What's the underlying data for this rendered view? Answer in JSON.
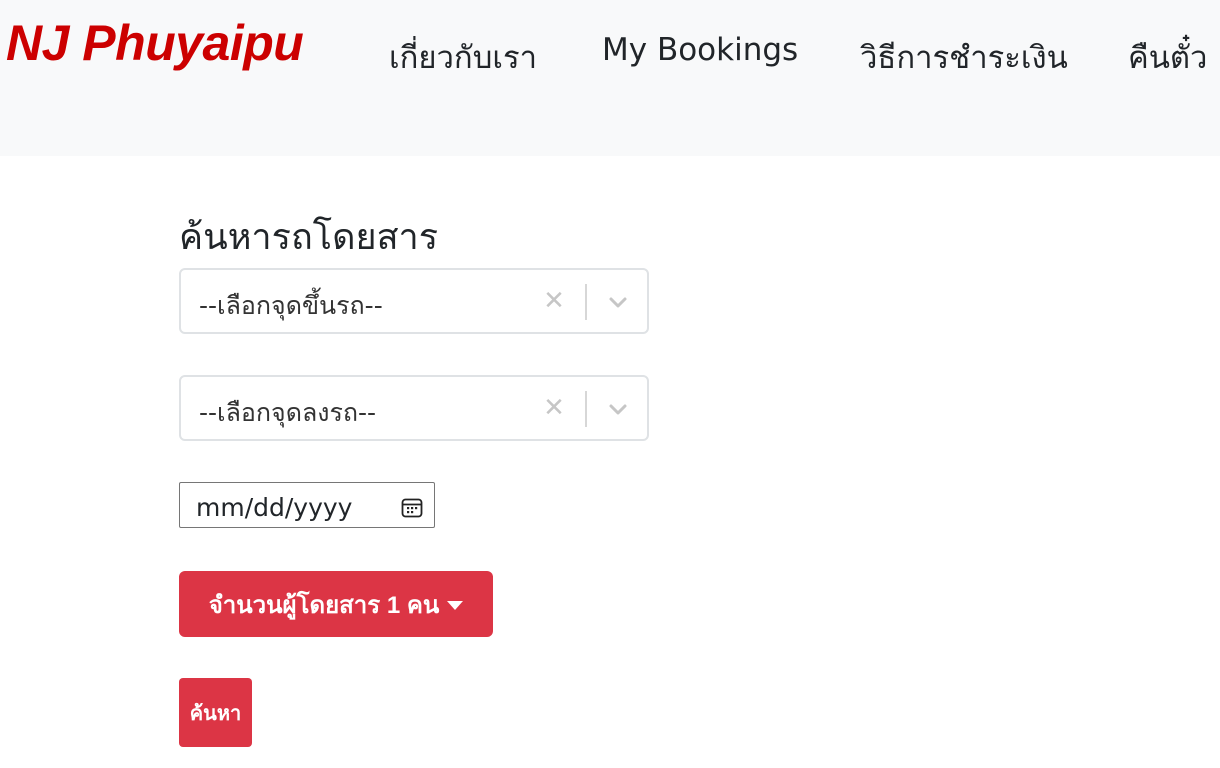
{
  "navbar": {
    "brand": "NJ Phuyaipu",
    "links": [
      {
        "label": "เกี่ยวกับเรา"
      },
      {
        "label": "My Bookings"
      },
      {
        "label": "วิธีการชำระเงิน"
      },
      {
        "label": "คืนตั๋ว"
      }
    ],
    "brand_color": "#cc0000"
  },
  "search": {
    "title": "ค้นหารถโดยสาร",
    "pickup": {
      "placeholder": "--เลือกจุดขึ้นรถ--",
      "clear_icon": "close-icon",
      "toggle_icon": "chevron-down-icon"
    },
    "dropoff": {
      "placeholder": "--เลือกจุดลงรถ--",
      "clear_icon": "close-icon",
      "toggle_icon": "chevron-down-icon"
    },
    "date": {
      "placeholder": "mm/dd/yyyy",
      "icon": "calendar-icon"
    },
    "passengers_label": "จำนวนผู้โดยสาร 1 คน",
    "submit_label": "ค้นหา",
    "accent_color": "#dc3545"
  }
}
